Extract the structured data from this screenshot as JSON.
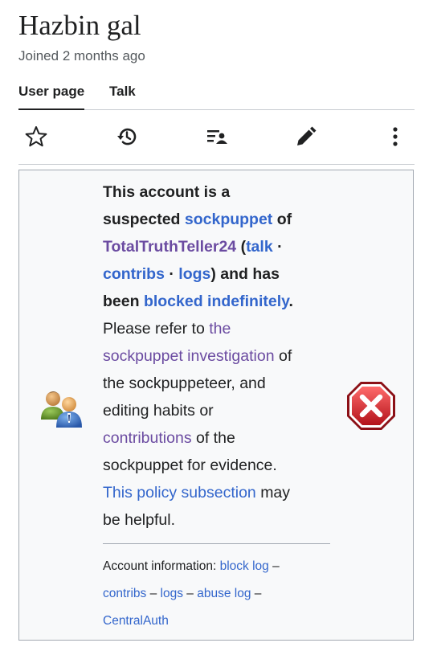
{
  "page": {
    "title": "Hazbin gal",
    "joined": "Joined 2 months ago"
  },
  "tabs": [
    {
      "label": "User page",
      "active": true
    },
    {
      "label": "Talk",
      "active": false
    }
  ],
  "toolbar": {
    "icons": [
      "star-icon",
      "history-icon",
      "user-contributions-icon",
      "edit-pencil-icon",
      "more-menu-icon"
    ]
  },
  "notice": {
    "p1": "This account is a",
    "p2_pre": "suspected",
    "p2_link": "sockpuppet",
    "p2_post": "of",
    "p3_link": "TotalTruthTeller24",
    "p3_paren": "(",
    "p3_talk": "talk",
    "p3_sep": "·",
    "p4_contribs": "contribs",
    "p4_sep": "·",
    "p4_logs": "logs",
    "p4_post": ") and has",
    "p5_pre": "been",
    "p5_link": "blocked indefinitely",
    "p5_post": ".",
    "p6_pre": "Please refer to",
    "p6_link": "the",
    "p7_link": "sockpuppet investigation",
    "p7_post": "of",
    "p8": "the sockpuppeteer, and",
    "p9": "editing habits or",
    "p10_link": "contributions",
    "p10_post": "of the",
    "p11": "sockpuppet for evidence.",
    "p12_link": "This policy subsection",
    "p12_post": "may",
    "p13": "be helpful."
  },
  "account_info": {
    "label": "Account information:",
    "block_log": "block log",
    "dash1": "–",
    "contribs": "contribs",
    "dash2": "–",
    "logs": "logs",
    "dash3": "–",
    "abuse_log": "abuse log",
    "dash4": "–",
    "centralauth": "CentralAuth"
  },
  "colors": {
    "link": "#3366cc",
    "visited_link": "#6b4ba1",
    "stop_red": "#d33",
    "box_bg": "#f8f9fa"
  }
}
